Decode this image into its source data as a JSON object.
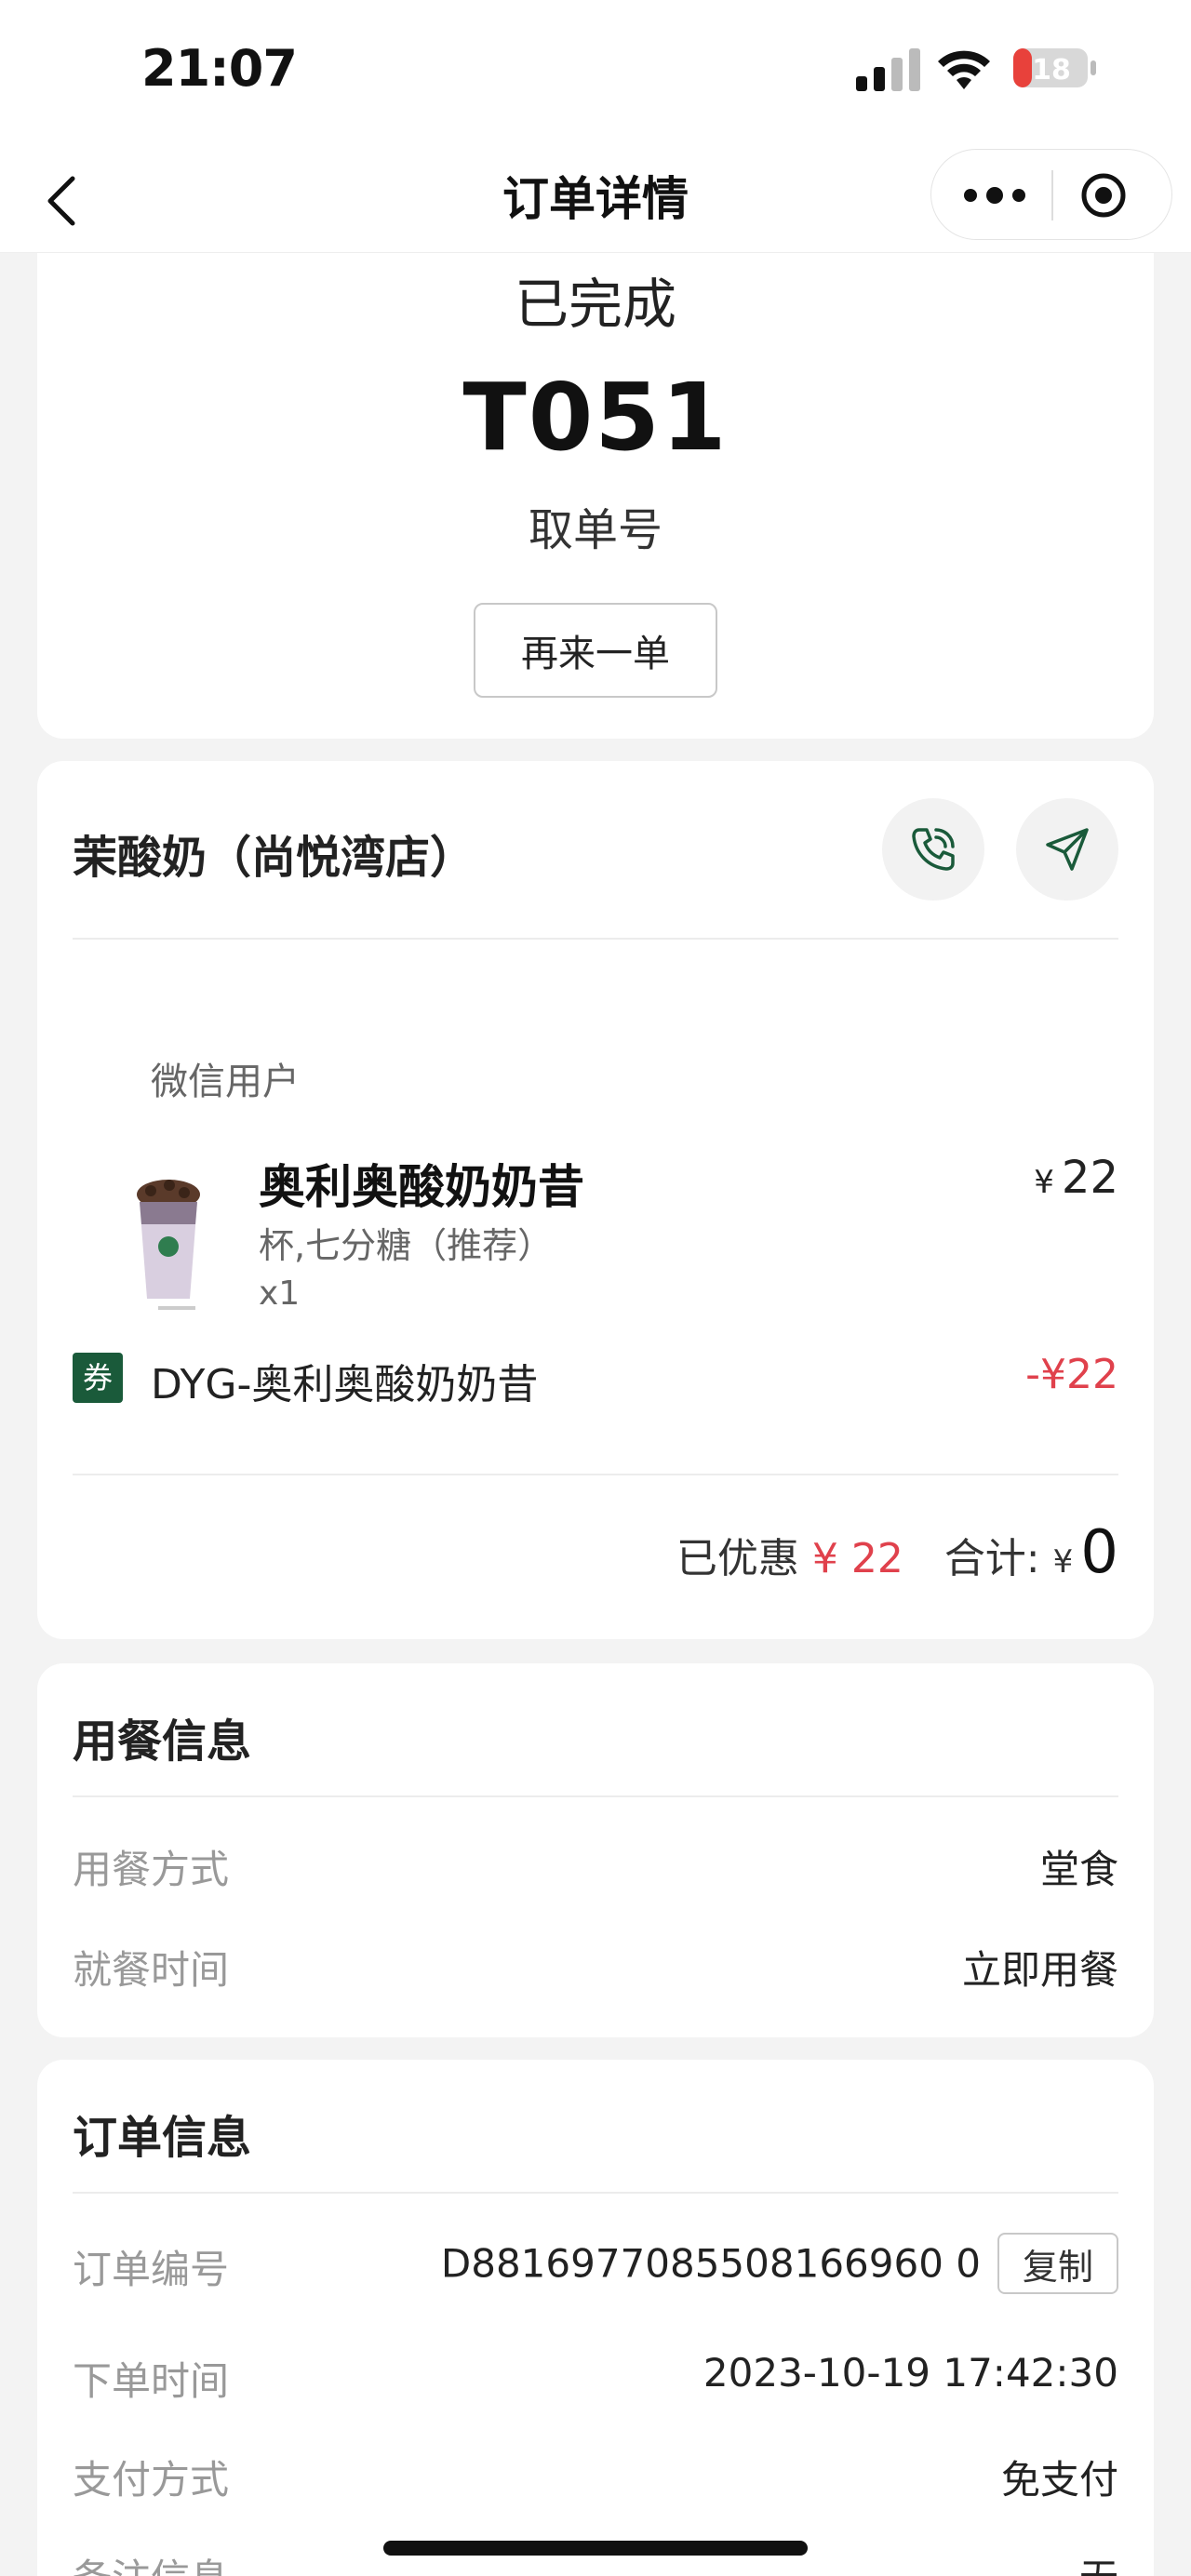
{
  "status_bar": {
    "time": "21:07",
    "battery": "18"
  },
  "nav": {
    "title": "订单详情"
  },
  "order_status": {
    "status": "已完成",
    "pickup_number": "T051",
    "pickup_label": "取单号",
    "reorder_label": "再来一单"
  },
  "store": {
    "name": "茉酸奶（尚悦湾店）",
    "user_label": "微信用户",
    "item": {
      "name": "奥利奥酸奶奶昔",
      "spec": "杯,七分糖（推荐）",
      "qty": "x1",
      "currency": "¥",
      "price": "22"
    },
    "coupon": {
      "tag": "券",
      "name": "DYG-奥利奥酸奶奶昔",
      "amount": "-¥22"
    },
    "summary": {
      "discount_label": "已优惠",
      "discount_value": "¥ 22",
      "total_label": "合计:",
      "total_currency": "¥",
      "total": "0"
    }
  },
  "dining": {
    "title": "用餐信息",
    "rows": [
      {
        "label": "用餐方式",
        "value": "堂食"
      },
      {
        "label": "就餐时间",
        "value": "立即用餐"
      }
    ]
  },
  "order_info": {
    "title": "订单信息",
    "order_no_label": "订单编号",
    "order_no": "D8816977085508166960 0",
    "copy_label": "复制",
    "rows": [
      {
        "label": "下单时间",
        "value": "2023-10-19 17:42:30"
      },
      {
        "label": "支付方式",
        "value": "免支付"
      },
      {
        "label": "备注信息",
        "value": "无"
      }
    ]
  },
  "colors": {
    "brand_green": "#1a5a3a",
    "discount_red": "#e0414c"
  }
}
